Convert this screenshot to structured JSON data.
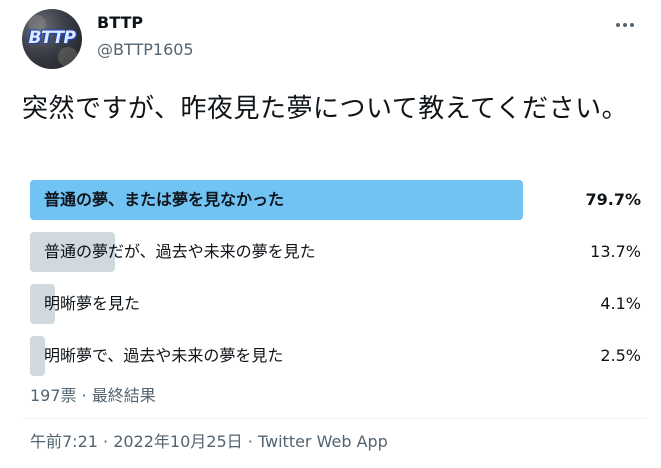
{
  "author": {
    "avatar_logo_text": "BTTP",
    "name": "BTTP",
    "handle": "@BTTP1605"
  },
  "tweet": {
    "text": "突然ですが、昨夜見た夢について教えてください。"
  },
  "poll": {
    "options": [
      {
        "label": "普通の夢、または夢を見なかった",
        "percent_text": "79.7%",
        "percent": 79.7,
        "winner": true
      },
      {
        "label": "普通の夢だが、過去や未来の夢を見た",
        "percent_text": "13.7%",
        "percent": 13.7,
        "winner": false
      },
      {
        "label": "明晰夢を見た",
        "percent_text": "4.1%",
        "percent": 4.1,
        "winner": false
      },
      {
        "label": "明晰夢で、過去や未来の夢を見た",
        "percent_text": "2.5%",
        "percent": 2.5,
        "winner": false
      }
    ],
    "summary": "197票 · 最終結果"
  },
  "footer": {
    "timestamp": "午前7:21 · 2022年10月25日 · Twitter Web App"
  },
  "icons": {
    "more": "more-horizontal-icon"
  },
  "colors": {
    "winner_bar": "#71c3f4",
    "other_bar": "#cfd9de",
    "secondary_text": "#536471"
  }
}
